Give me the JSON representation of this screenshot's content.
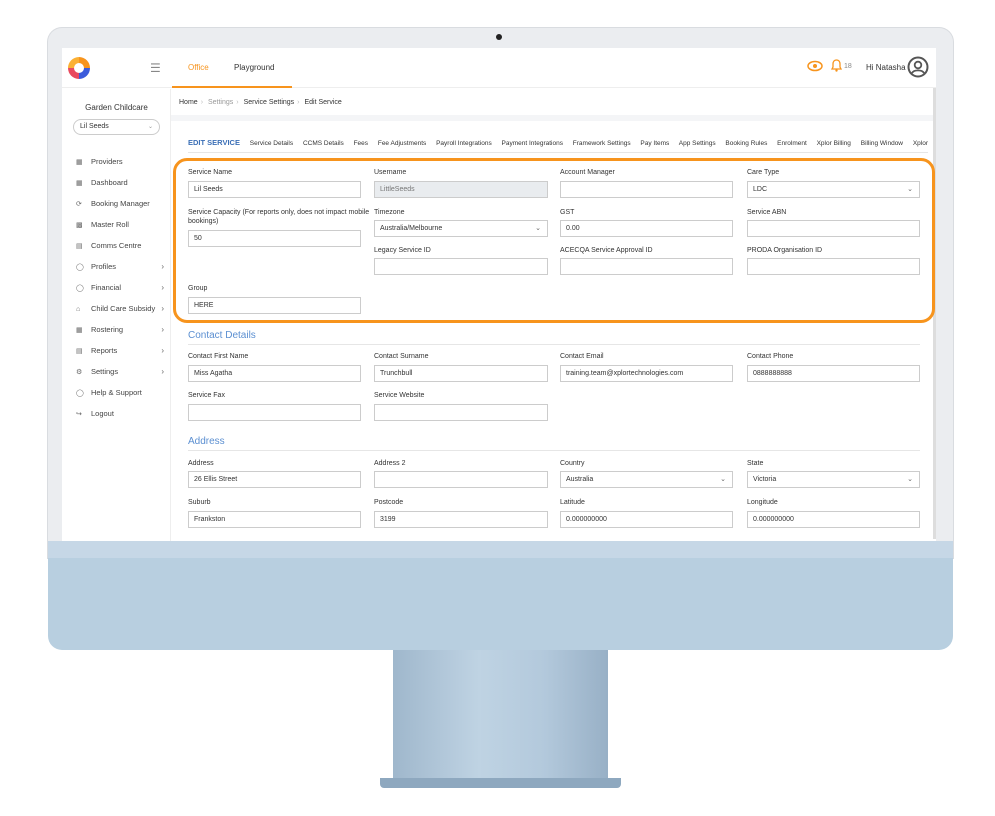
{
  "topbar": {
    "tabs": [
      "Office",
      "Playground"
    ],
    "notification_count": "18",
    "greeting": "Hi Natasha"
  },
  "sidebar": {
    "org_name": "Garden Childcare",
    "service_select": "Lil Seeds",
    "items": [
      {
        "label": "Providers",
        "icon": "building-icon",
        "arrow": false
      },
      {
        "label": "Dashboard",
        "icon": "grid-icon",
        "arrow": false
      },
      {
        "label": "Booking Manager",
        "icon": "refresh-icon",
        "arrow": false
      },
      {
        "label": "Master Roll",
        "icon": "roll-icon",
        "arrow": false
      },
      {
        "label": "Comms Centre",
        "icon": "chat-icon",
        "arrow": false
      },
      {
        "label": "Profiles",
        "icon": "profile-icon",
        "arrow": true
      },
      {
        "label": "Financial",
        "icon": "dollar-icon",
        "arrow": true
      },
      {
        "label": "Child Care Subsidy",
        "icon": "bank-icon",
        "arrow": true
      },
      {
        "label": "Rostering",
        "icon": "calendar-icon",
        "arrow": true
      },
      {
        "label": "Reports",
        "icon": "report-icon",
        "arrow": true
      },
      {
        "label": "Settings",
        "icon": "gear-icon",
        "arrow": true
      },
      {
        "label": "Help & Support",
        "icon": "help-icon",
        "arrow": false
      },
      {
        "label": "Logout",
        "icon": "logout-icon",
        "arrow": false
      }
    ]
  },
  "breadcrumb": [
    "Home",
    "Settings",
    "Service Settings",
    "Edit Service"
  ],
  "tabs": [
    "EDIT SERVICE",
    "Service Details",
    "CCMS Details",
    "Fees",
    "Fee Adjustments",
    "Payroll Integrations",
    "Payment Integrations",
    "Framework Settings",
    "Pay Items",
    "App Settings",
    "Booking Rules",
    "Enrolment",
    "Xplor Billing",
    "Billing Window",
    "Xplor"
  ],
  "service": {
    "service_name_label": "Service Name",
    "service_name": "Lil Seeds",
    "username_label": "Username",
    "username": "LittleSeeds",
    "account_manager_label": "Account Manager",
    "account_manager": "",
    "care_type_label": "Care Type",
    "care_type": "LDC",
    "capacity_label_1": "Service Capacity (For reports only, does not impact mobile",
    "capacity_label_2": "bookings)",
    "capacity": "50",
    "timezone_label": "Timezone",
    "timezone": "Australia/Melbourne",
    "gst_label": "GST",
    "gst": "0.00",
    "abn_label": "Service ABN",
    "abn": "",
    "legacy_label": "Legacy Service ID",
    "legacy": "",
    "acecqa_label": "ACECQA Service Approval ID",
    "acecqa": "",
    "proda_label": "PRODA Organisation ID",
    "proda": "",
    "group_label": "Group",
    "group": "HERE"
  },
  "contact": {
    "title": "Contact Details",
    "first_name_label": "Contact First Name",
    "first_name": "Miss Agatha",
    "surname_label": "Contact Surname",
    "surname": "Trunchbull",
    "email_label": "Contact Email",
    "email": "training.team@xplortechnologies.com",
    "phone_label": "Contact Phone",
    "phone": "0888888888",
    "fax_label": "Service Fax",
    "fax": "",
    "website_label": "Service Website",
    "website": ""
  },
  "address": {
    "title": "Address",
    "address_label": "Address",
    "address": "26 Ellis Street",
    "address2_label": "Address 2",
    "address2": "",
    "country_label": "Country",
    "country": "Australia",
    "state_label": "State",
    "state": "Victoria",
    "suburb_label": "Suburb",
    "suburb": "Frankston",
    "postcode_label": "Postcode",
    "postcode": "3199",
    "latitude_label": "Latitude",
    "latitude": "0.000000000",
    "longitude_label": "Longitude",
    "longitude": "0.000000000"
  },
  "colors": {
    "accent": "#f7941d",
    "link": "#3b6fb6",
    "section": "#5b8fd1",
    "frame": "#b8cfe0"
  }
}
